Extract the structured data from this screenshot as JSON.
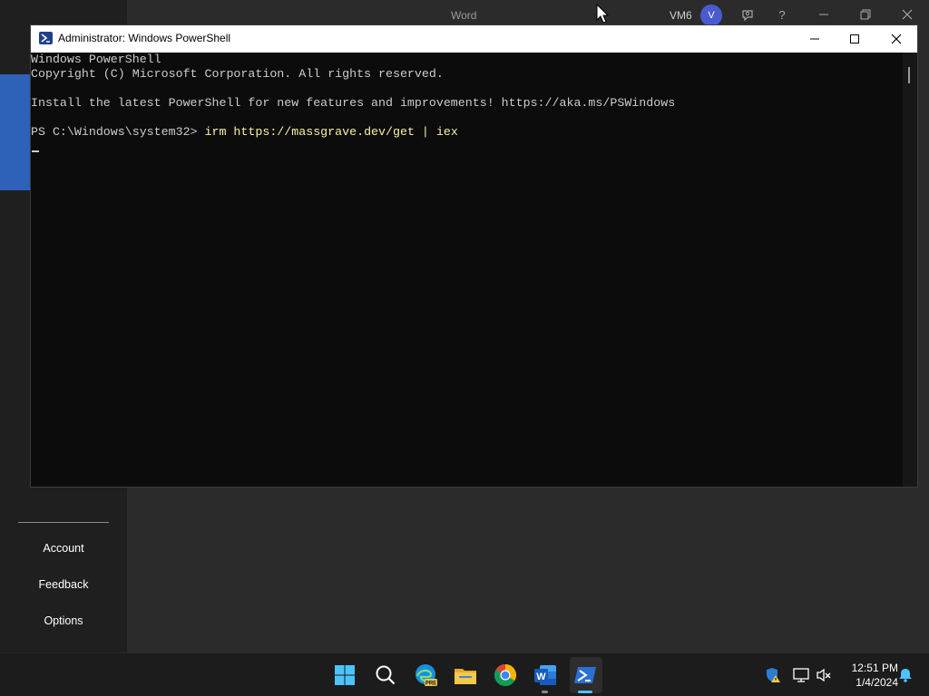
{
  "word": {
    "title": "Word",
    "user_initials": "VM6",
    "avatar_letter": "V",
    "sidebar": {
      "items": [
        {
          "label": "Account"
        },
        {
          "label": "Feedback"
        },
        {
          "label": "Options"
        }
      ]
    },
    "titlebar_buttons": [
      "coauthor-icon",
      "help-icon",
      "minimize-icon",
      "restore-icon",
      "close-icon"
    ],
    "help_label": "?"
  },
  "powershell": {
    "title": "Administrator: Windows PowerShell",
    "lines": [
      "Windows PowerShell",
      "Copyright (C) Microsoft Corporation. All rights reserved.",
      "",
      "Install the latest PowerShell for new features and improvements! https://aka.ms/PSWindows",
      "",
      "PS C:\\Windows\\system32> "
    ],
    "prompt": "PS C:\\Windows\\system32> ",
    "command": "irm https://massgrave.dev/get | iex",
    "colors": {
      "background": "#0c0c0c",
      "text": "#cccccc",
      "command": "#f9f1a5"
    }
  },
  "taskbar": {
    "apps": [
      {
        "name": "start-icon",
        "label": "Start"
      },
      {
        "name": "search-icon",
        "label": "Search"
      },
      {
        "name": "edge-preview-icon",
        "label": "Microsoft Edge Preview",
        "badge": "PRE"
      },
      {
        "name": "file-explorer-icon",
        "label": "File Explorer"
      },
      {
        "name": "chrome-icon",
        "label": "Google Chrome"
      },
      {
        "name": "word-icon",
        "label": "Word",
        "letter": "W"
      },
      {
        "name": "powershell-icon",
        "label": "Windows PowerShell",
        "active": true
      }
    ],
    "tray": [
      "security-warning-icon",
      "network-icon",
      "volume-muted-icon"
    ],
    "time": "12:51 PM",
    "date": "1/4/2024",
    "colors": {
      "accent": "#4cc2ff"
    }
  }
}
